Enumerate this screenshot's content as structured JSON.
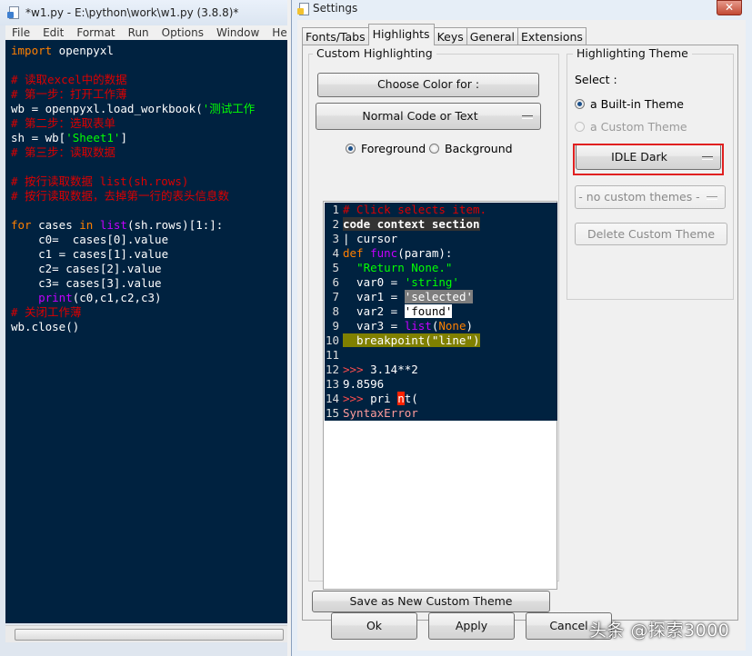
{
  "editor": {
    "title": "*w1.py - E:\\python\\work\\w1.py (3.8.8)*",
    "menus": [
      "File",
      "Edit",
      "Format",
      "Run",
      "Options",
      "Window",
      "Hel"
    ],
    "code": [
      [
        {
          "t": "import",
          "c": "kw"
        },
        {
          "t": " openpyxl",
          "c": "def"
        }
      ],
      [],
      [
        {
          "t": "# 读取excel中的数据",
          "c": "cm"
        }
      ],
      [
        {
          "t": "# 第一步：打开工作薄",
          "c": "cm"
        }
      ],
      [
        {
          "t": "wb = openpyxl.load_workbook(",
          "c": "def"
        },
        {
          "t": "'测试工作",
          "c": "str"
        }
      ],
      [
        {
          "t": "# 第二步：选取表单",
          "c": "cm"
        }
      ],
      [
        {
          "t": "sh = wb[",
          "c": "def"
        },
        {
          "t": "'Sheet1'",
          "c": "str"
        },
        {
          "t": "]",
          "c": "def"
        }
      ],
      [
        {
          "t": "# 第三步：读取数据",
          "c": "cm"
        }
      ],
      [],
      [
        {
          "t": "# 按行读取数据 list(sh.rows)",
          "c": "cm"
        }
      ],
      [
        {
          "t": "# 按行读取数据，去掉第一行的表头信息数",
          "c": "cm"
        }
      ],
      [],
      [
        {
          "t": "for",
          "c": "kw"
        },
        {
          "t": " cases ",
          "c": "def"
        },
        {
          "t": "in",
          "c": "kw"
        },
        {
          "t": " ",
          "c": "def"
        },
        {
          "t": "list",
          "c": "bi"
        },
        {
          "t": "(sh.rows)[1:]:",
          "c": "def"
        }
      ],
      [
        {
          "t": "    c0=  cases[0].value",
          "c": "def"
        }
      ],
      [
        {
          "t": "    c1 = cases[1].value",
          "c": "def"
        }
      ],
      [
        {
          "t": "    c2= cases[2].value",
          "c": "def"
        }
      ],
      [
        {
          "t": "    c3= cases[3].value",
          "c": "def"
        }
      ],
      [
        {
          "t": "    ",
          "c": "def"
        },
        {
          "t": "print",
          "c": "bi"
        },
        {
          "t": "(c0,c1,c2,c3)",
          "c": "def"
        }
      ],
      [
        {
          "t": "# 关闭工作薄",
          "c": "cm"
        }
      ],
      [
        {
          "t": "wb.close()",
          "c": "def"
        }
      ]
    ]
  },
  "settings": {
    "title": "Settings",
    "close_glyph": "✕",
    "tabs": [
      "Fonts/Tabs",
      "Highlights",
      "Keys",
      "General",
      "Extensions"
    ],
    "active_tab": "Highlights",
    "custom_highlighting": {
      "legend": "Custom Highlighting",
      "choose_color_label": "Choose Color for :",
      "element_label": "Normal Code or Text",
      "foreground_label": "Foreground",
      "background_label": "Background",
      "foreground_selected": true
    },
    "sample": [
      {
        "n": "1",
        "parts": [
          {
            "t": "# Click selects item.",
            "c": "err"
          }
        ]
      },
      {
        "n": "2",
        "parts": [
          {
            "t": "code context section",
            "c": "ctx"
          }
        ]
      },
      {
        "n": "3",
        "parts": [
          {
            "t": "| cursor",
            "c": "cursor"
          }
        ]
      },
      {
        "n": "4",
        "parts": [
          {
            "t": "def",
            "c": "kw"
          },
          {
            "t": " ",
            "c": "def"
          },
          {
            "t": "func",
            "c": "bi"
          },
          {
            "t": "(param):",
            "c": "def"
          }
        ]
      },
      {
        "n": "5",
        "parts": [
          {
            "t": "  ",
            "c": "def"
          },
          {
            "t": "\"Return None.\"",
            "c": "str"
          }
        ]
      },
      {
        "n": "6",
        "parts": [
          {
            "t": "  var0 = ",
            "c": "def"
          },
          {
            "t": "'string'",
            "c": "str"
          }
        ]
      },
      {
        "n": "7",
        "parts": [
          {
            "t": "  var1 = ",
            "c": "def"
          },
          {
            "t": "'selected'",
            "c": "sel"
          }
        ]
      },
      {
        "n": "8",
        "parts": [
          {
            "t": "  var2 = ",
            "c": "def"
          },
          {
            "t": "'found'",
            "c": "found"
          }
        ]
      },
      {
        "n": "9",
        "parts": [
          {
            "t": "  var3 = ",
            "c": "def"
          },
          {
            "t": "list",
            "c": "bi"
          },
          {
            "t": "(",
            "c": "def"
          },
          {
            "t": "None",
            "c": "kw"
          },
          {
            "t": ")",
            "c": "def"
          }
        ]
      },
      {
        "n": "10",
        "parts": [
          {
            "t": "  breakpoint(\"line\")",
            "c": "bp"
          }
        ]
      },
      {
        "n": "11",
        "parts": []
      },
      {
        "n": "12",
        "parts": [
          {
            "t": ">>>",
            "c": "prompt"
          },
          {
            "t": " 3.14**2",
            "c": "def"
          }
        ]
      },
      {
        "n": "13",
        "parts": [
          {
            "t": "9.8596",
            "c": "out"
          }
        ]
      },
      {
        "n": "14",
        "parts": [
          {
            "t": ">>>",
            "c": "prompt"
          },
          {
            "t": " pri ",
            "c": "def"
          },
          {
            "t": "n",
            "c": "errmark"
          },
          {
            "t": "t(",
            "c": "def"
          }
        ]
      },
      {
        "n": "15",
        "parts": [
          {
            "t": "SyntaxError",
            "c": "stderr"
          }
        ]
      }
    ],
    "save_new_theme_label": "Save as New Custom Theme",
    "theme": {
      "legend": "Highlighting Theme",
      "select_label": "Select :",
      "builtin_label": "a Built-in Theme",
      "custom_label": "a Custom Theme",
      "builtin_selected": true,
      "builtin_value": "IDLE Dark",
      "custom_value": "- no custom themes -",
      "delete_label": "Delete Custom Theme"
    },
    "buttons": {
      "ok": "Ok",
      "apply": "Apply",
      "cancel": "Cancel"
    }
  },
  "watermark": "头条 @探索3000",
  "colors": {
    "editor_bg": "#002240",
    "comment": "#dd0000",
    "keyword": "#ff8000",
    "string": "#02ff02",
    "builtin": "#c300ff",
    "annotation_box": "#e02020"
  }
}
